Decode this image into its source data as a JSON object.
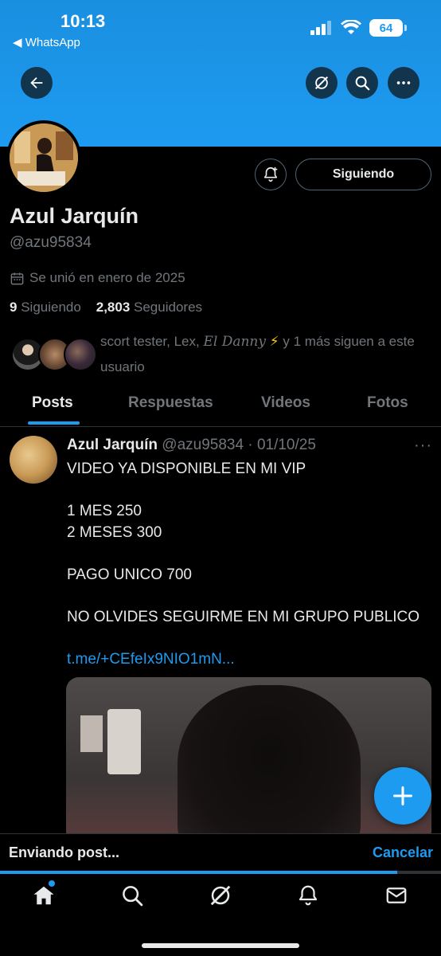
{
  "status_bar": {
    "time": "10:13",
    "back_app": "◀ WhatsApp",
    "battery": "64"
  },
  "header": {
    "back_icon": "arrow-left-icon",
    "grok_icon": "grok-icon",
    "search_icon": "search-icon",
    "more_icon": "more-icon"
  },
  "profile": {
    "name": "Azul Jarquín",
    "handle": "@azu95834",
    "joined": "Se unió en enero de 2025",
    "following_count": "9",
    "following_label": "Siguiendo",
    "followers_count": "2,803",
    "followers_label": "Seguidores",
    "follow_button": "Siguiendo",
    "followed_by_names": "scort tester, Lex,",
    "followed_by_italic": "El Danny",
    "followed_by_emoji": "⚡",
    "followed_by_rest": "y 1 más siguen a este usuario"
  },
  "tabs": [
    {
      "label": "Posts",
      "active": true
    },
    {
      "label": "Respuestas",
      "active": false
    },
    {
      "label": "Videos",
      "active": false
    },
    {
      "label": "Fotos",
      "active": false
    }
  ],
  "post": {
    "author": "Azul Jarquín",
    "meta": "@azu95834 · 01/10/25",
    "lines": [
      "VIDEO YA DISPONIBLE EN MI VIP",
      "",
      "1 MES 250",
      "2 MESES 300",
      "",
      "PAGO UNICO 700",
      "",
      "NO OLVIDES SEGUIRME EN MI GRUPO PUBLICO",
      ""
    ],
    "link": "t.me/+CEfeIx9NIO1mN..."
  },
  "sending_bar": {
    "label": "Enviando post...",
    "cancel": "Cancelar",
    "progress": 0.9
  },
  "bottom_nav": [
    "home-icon",
    "search-icon",
    "grok-icon",
    "bell-icon",
    "mail-icon"
  ],
  "colors": {
    "accent": "#1d9bf0",
    "text": "#e7e9ea",
    "muted": "#71767b",
    "background": "#000000"
  }
}
